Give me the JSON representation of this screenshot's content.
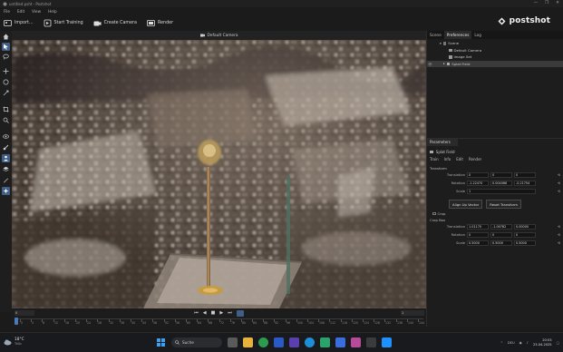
{
  "window": {
    "title": "untitled.psht - Postshot",
    "minimize": "—",
    "maximize": "❐",
    "close": "✕"
  },
  "menu": [
    "File",
    "Edit",
    "View",
    "Help"
  ],
  "toolbar": {
    "import": "Import...",
    "start_training": "Start Training",
    "create_camera": "Create Camera",
    "render": "Render"
  },
  "logo": {
    "text": "postshot"
  },
  "viewport": {
    "camera_label": "Default Camera"
  },
  "timeline": {
    "frame_start": "0",
    "frame_end": "1",
    "controls": [
      "⏮",
      "◀",
      "■",
      "▶",
      "⏭"
    ],
    "ruler": [
      "0",
      "4",
      "8",
      "12",
      "16",
      "20",
      "24",
      "28",
      "32",
      "36",
      "40",
      "44",
      "48",
      "52",
      "56",
      "60",
      "64",
      "68",
      "72",
      "76",
      "80",
      "84",
      "88",
      "92",
      "96",
      "100",
      "104",
      "108",
      "112",
      "116",
      "120",
      "124",
      "128",
      "132",
      "136",
      "140",
      "144"
    ]
  },
  "right_panel": {
    "tabs": [
      "Scene",
      "Preferences",
      "Log"
    ],
    "tree": [
      {
        "label": "Scene",
        "depth": 0
      },
      {
        "label": "Default Camera",
        "depth": 1
      },
      {
        "label": "Image Set",
        "depth": 1
      },
      {
        "label": "Splat Field",
        "depth": 1
      }
    ]
  },
  "parameters": {
    "header": "Parameters",
    "object": "Splat Field",
    "subtabs": [
      "Train",
      "Info",
      "Edit",
      "Render"
    ],
    "transform_label": "Transform",
    "translation": {
      "label": "Translation",
      "values": [
        "0",
        "0",
        "0"
      ]
    },
    "rotation": {
      "label": "Rotation",
      "values": [
        "-1.22470",
        "0.004066",
        "-0.21754"
      ]
    },
    "scale": {
      "label": "Scale",
      "values": [
        "1"
      ]
    },
    "buttons": [
      "Align Up Vector",
      "Reset Transform"
    ],
    "crop": "Crop",
    "crop_box": "Crop Box",
    "crop_translation": {
      "label": "Translation",
      "values": [
        "1.01170",
        "-1.00782",
        "0.00000"
      ]
    },
    "crop_rotation": {
      "label": "Rotation",
      "values": [
        "0",
        "0",
        "0"
      ]
    },
    "crop_scale": {
      "label": "Scale",
      "values": [
        "0.5000",
        "0.5000",
        "0.5000"
      ]
    },
    "reset_icon": "⟲"
  },
  "taskbar": {
    "temp": "18°C",
    "condition": "Trüb",
    "search": "Suche",
    "time": "20:53",
    "date": "23.04.2025",
    "lang": "DEU"
  },
  "colors": {
    "accent": "#3f5f86",
    "bg": "#1b1b1b"
  }
}
